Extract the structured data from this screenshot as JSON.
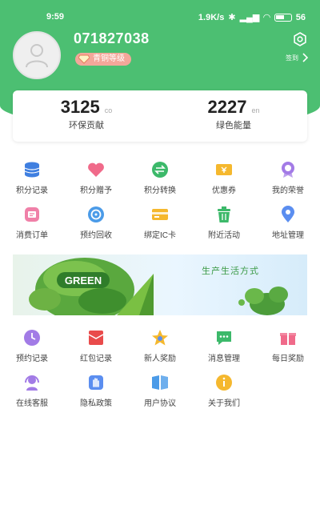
{
  "status_bar": {
    "time": "9:59",
    "network_speed": "1.9K/s",
    "battery": "56"
  },
  "profile": {
    "username": "071827038",
    "level_badge": "青铜等级",
    "sign_in_label": "签到"
  },
  "stats": [
    {
      "value": "3125",
      "unit": "co",
      "label": "环保贡献"
    },
    {
      "value": "2227",
      "unit": "en",
      "label": "绿色能量"
    }
  ],
  "menu_top": [
    {
      "label": "积分记录",
      "icon": "database-icon",
      "color": "#3f7fe0"
    },
    {
      "label": "积分赠予",
      "icon": "heart-icon",
      "color": "#f06a8a"
    },
    {
      "label": "积分转换",
      "icon": "exchange-icon",
      "color": "#3cb96a"
    },
    {
      "label": "优惠券",
      "icon": "coupon-icon",
      "color": "#f5b82e"
    },
    {
      "label": "我的荣誉",
      "icon": "medal-icon",
      "color": "#a37be6"
    },
    {
      "label": "消费订单",
      "icon": "order-icon",
      "color": "#f080a8"
    },
    {
      "label": "预约回收",
      "icon": "recycle-icon",
      "color": "#4b9be8"
    },
    {
      "label": "绑定IC卡",
      "icon": "card-icon",
      "color": "#f5b82e"
    },
    {
      "label": "附近活动",
      "icon": "trash-icon",
      "color": "#3cb96a"
    },
    {
      "label": "地址管理",
      "icon": "location-pin-icon",
      "color": "#5b8ef0"
    }
  ],
  "banner": {
    "badge_text": "GREEN",
    "slogan": "生产生活方式"
  },
  "menu_bottom": [
    {
      "label": "预约记录",
      "icon": "clock-icon",
      "color": "#a27be6"
    },
    {
      "label": "红包记录",
      "icon": "red-envelope-icon",
      "color": "#e94b4b"
    },
    {
      "label": "新人奖励",
      "icon": "star-icon",
      "color": "#f5b82e"
    },
    {
      "label": "消息管理",
      "icon": "message-icon",
      "color": "#3cb96a"
    },
    {
      "label": "每日奖励",
      "icon": "gift-icon",
      "color": "#f06a8a"
    },
    {
      "label": "在线客服",
      "icon": "headset-icon",
      "color": "#a27be6"
    },
    {
      "label": "隐私政策",
      "icon": "hand-icon",
      "color": "#5b8ef0"
    },
    {
      "label": "用户协议",
      "icon": "book-icon",
      "color": "#4b9be8"
    },
    {
      "label": "关于我们",
      "icon": "info-icon",
      "color": "#f5b82e"
    }
  ]
}
